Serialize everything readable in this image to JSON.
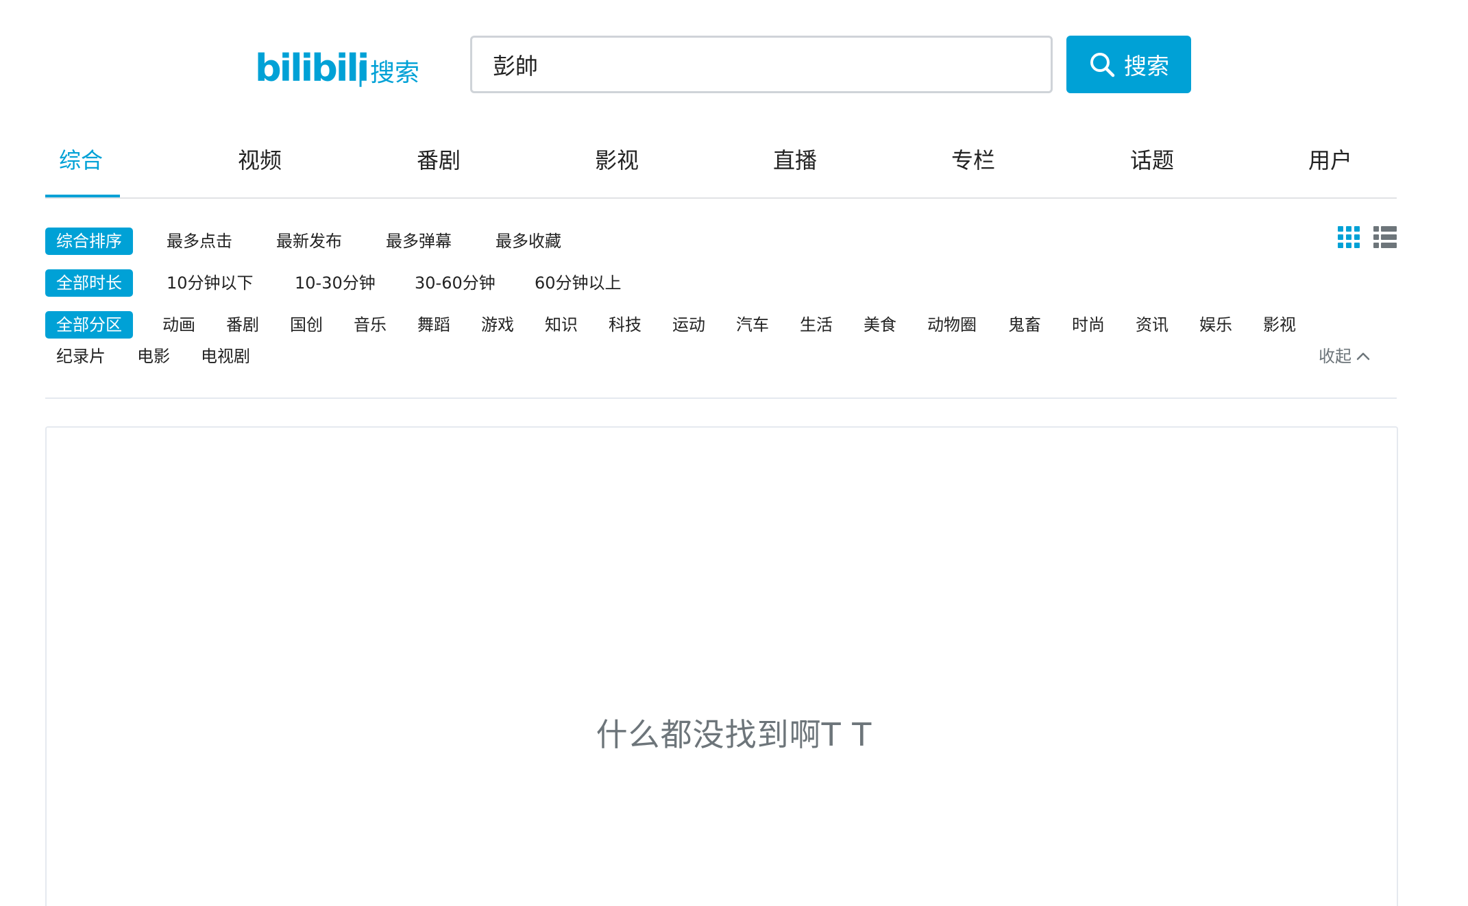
{
  "header": {
    "logo_brand": "bilibili",
    "logo_separator": "|",
    "logo_suffix": "搜索",
    "search_value": "彭帥",
    "search_button_label": "搜索"
  },
  "tabs": [
    {
      "label": "综合",
      "active": true
    },
    {
      "label": "视频"
    },
    {
      "label": "番剧"
    },
    {
      "label": "影视"
    },
    {
      "label": "直播"
    },
    {
      "label": "专栏"
    },
    {
      "label": "话题"
    },
    {
      "label": "用户"
    }
  ],
  "filters": {
    "sort": {
      "selected": "综合排序",
      "options": [
        "最多点击",
        "最新发布",
        "最多弹幕",
        "最多收藏"
      ]
    },
    "duration": {
      "selected": "全部时长",
      "options": [
        "10分钟以下",
        "10-30分钟",
        "30-60分钟",
        "60分钟以上"
      ]
    },
    "zone": {
      "selected": "全部分区",
      "options": [
        "动画",
        "番剧",
        "国创",
        "音乐",
        "舞蹈",
        "游戏",
        "知识",
        "科技",
        "运动",
        "汽车",
        "生活",
        "美食",
        "动物圈",
        "鬼畜",
        "时尚",
        "资讯",
        "娱乐",
        "影视"
      ],
      "options_row2": [
        "纪录片",
        "电影",
        "电视剧"
      ],
      "collapse_label": "收起"
    }
  },
  "view_toggle": {
    "grid_icon": "grid-view-icon",
    "list_icon": "list-view-icon"
  },
  "results": {
    "empty_message": "什么都没找到啊T T"
  },
  "colors": {
    "accent": "#00a1d6",
    "text": "#212121",
    "muted": "#6d757a",
    "border": "#e5e9ef"
  }
}
